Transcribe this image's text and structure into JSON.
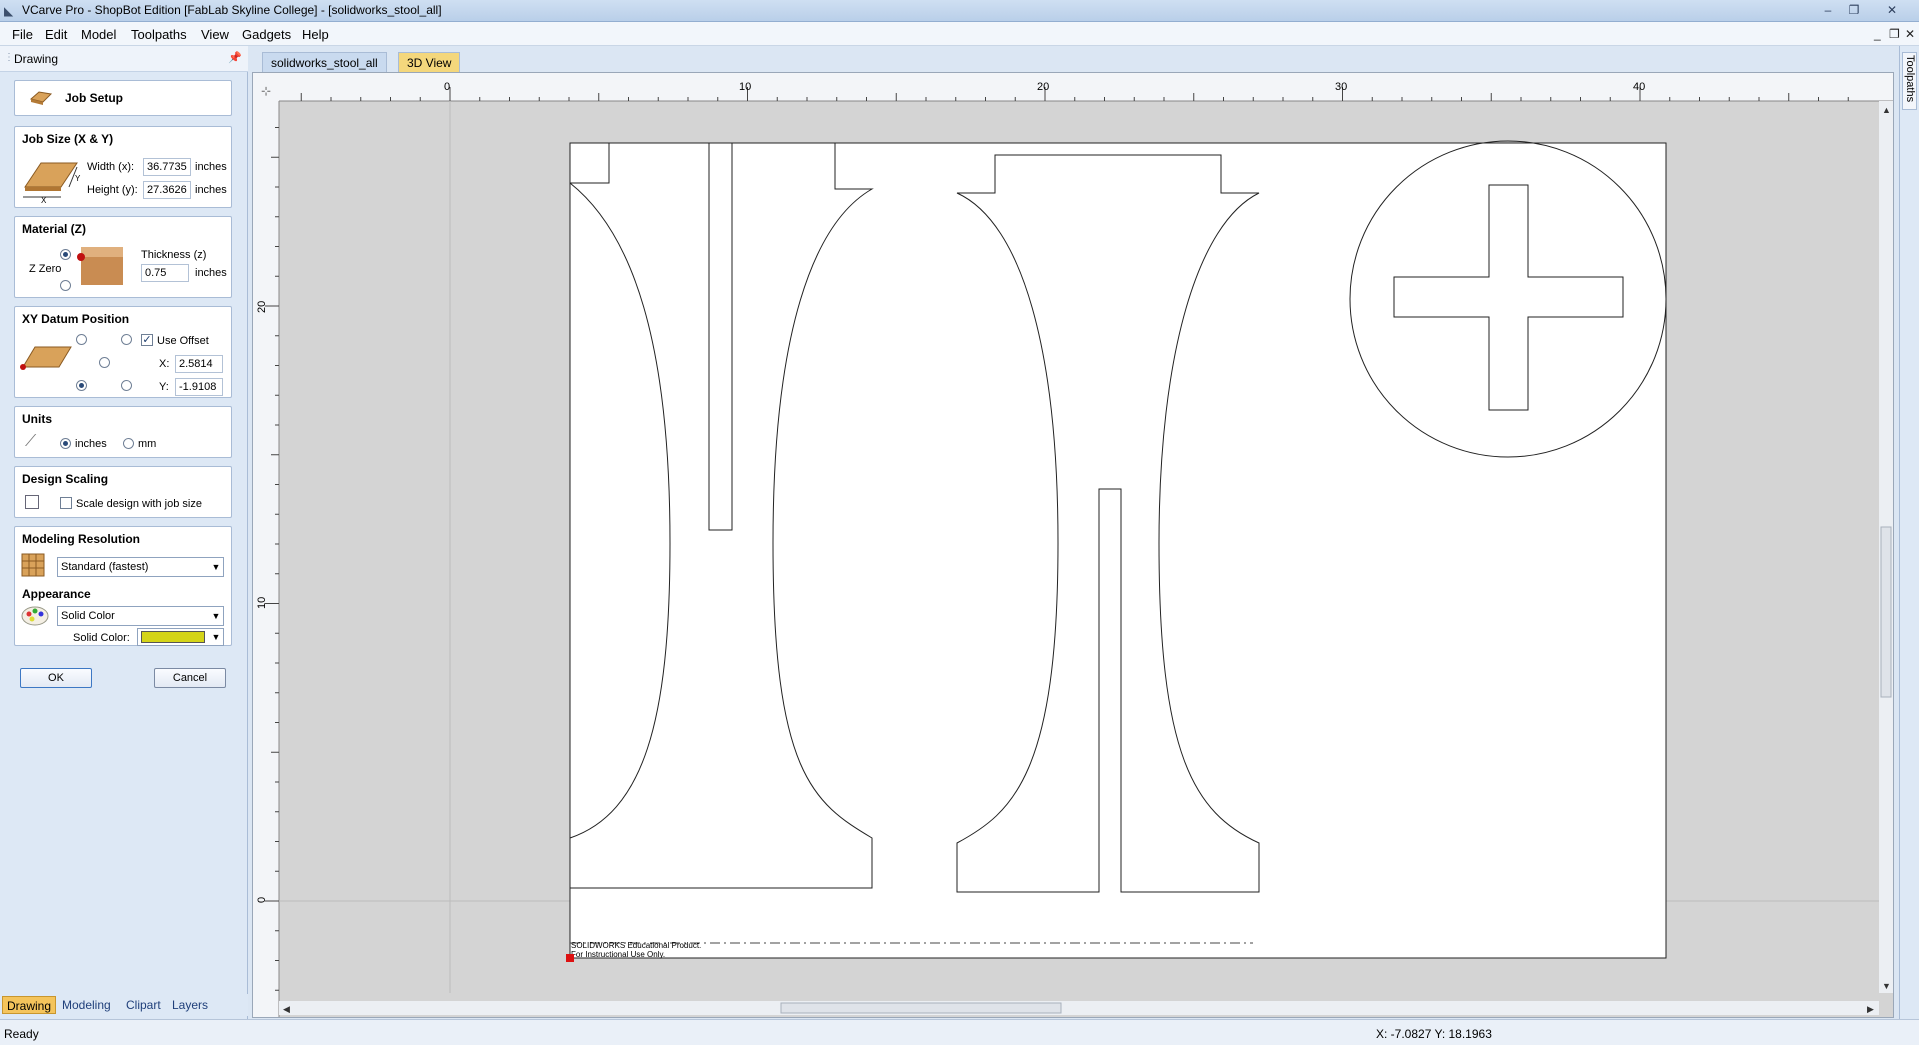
{
  "window": {
    "title": "VCarve Pro - ShopBot Edition [FabLab Skyline College] - [solidworks_stool_all]"
  },
  "menu": [
    "File",
    "Edit",
    "Model",
    "Toolpaths",
    "View",
    "Gadgets",
    "Help"
  ],
  "panel": {
    "header": "Drawing",
    "job_setup": "Job Setup",
    "job_size": {
      "title": "Job Size (X & Y)",
      "width_label": "Width (x):",
      "width_value": "36.7735",
      "height_label": "Height (y):",
      "height_value": "27.3626",
      "unit": "inches"
    },
    "material": {
      "title": "Material (Z)",
      "zzero_label": "Z Zero",
      "thickness_label": "Thickness (z)",
      "thickness_value": "0.75",
      "unit": "inches"
    },
    "datum": {
      "title": "XY Datum Position",
      "use_offset_label": "Use Offset",
      "x_label": "X:",
      "x_value": "2.5814",
      "y_label": "Y:",
      "y_value": "-1.9108"
    },
    "units": {
      "title": "Units",
      "inches": "inches",
      "mm": "mm"
    },
    "scaling": {
      "title": "Design Scaling",
      "scale_label": "Scale design with job size"
    },
    "resolution": {
      "title": "Modeling Resolution",
      "selected": "Standard (fastest)"
    },
    "appearance": {
      "title": "Appearance",
      "selected": "Solid Color",
      "solid_color_label": "Solid Color:",
      "swatch_color": "#d4d418"
    },
    "ok": "OK",
    "cancel": "Cancel",
    "bottom_tabs": [
      "Drawing",
      "Modeling",
      "Clipart",
      "Layers"
    ]
  },
  "doc_tabs": [
    "solidworks_stool_all",
    "3D View"
  ],
  "side_tab": "Toolpaths",
  "ruler": {
    "h_labels": [
      "0",
      "10",
      "20",
      "30",
      "40"
    ],
    "v_labels": [
      "20",
      "10",
      "0"
    ]
  },
  "canvas": {
    "watermark_line1": "SOLIDWORKS Educational Product.",
    "watermark_line2": "For Instructional Use Only."
  },
  "status": {
    "left": "Ready",
    "coords": "X: -7.0827 Y: 18.1963"
  }
}
